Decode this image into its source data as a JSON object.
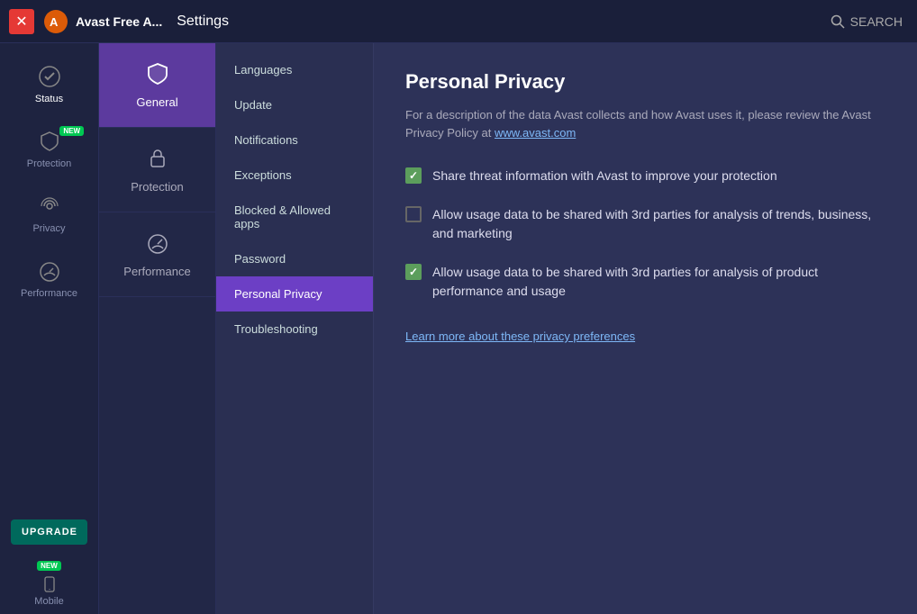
{
  "topbar": {
    "app_name": "Avast Free A...",
    "settings_label": "Settings",
    "search_label": "SEARCH"
  },
  "sidebar_icons": {
    "items": [
      {
        "id": "status",
        "label": "Status",
        "icon": "check-circle"
      },
      {
        "id": "protection",
        "label": "Protection",
        "icon": "shield",
        "badge": "NEW"
      },
      {
        "id": "privacy",
        "label": "Privacy",
        "icon": "fingerprint"
      },
      {
        "id": "performance",
        "label": "Performance",
        "icon": "gauge"
      }
    ],
    "upgrade_label": "UPGRADE",
    "mobile_label": "Mobile",
    "badge_new": "NEW"
  },
  "sidebar_categories": {
    "items": [
      {
        "id": "general",
        "label": "General",
        "icon": "shield",
        "active": true
      },
      {
        "id": "protection",
        "label": "Protection",
        "icon": "lock"
      },
      {
        "id": "performance",
        "label": "Performance",
        "icon": "gauge"
      }
    ]
  },
  "sidebar_menu": {
    "items": [
      {
        "id": "languages",
        "label": "Languages"
      },
      {
        "id": "update",
        "label": "Update"
      },
      {
        "id": "notifications",
        "label": "Notifications"
      },
      {
        "id": "exceptions",
        "label": "Exceptions"
      },
      {
        "id": "blocked-allowed",
        "label": "Blocked & Allowed apps"
      },
      {
        "id": "password",
        "label": "Password"
      },
      {
        "id": "personal-privacy",
        "label": "Personal Privacy",
        "active": true
      },
      {
        "id": "troubleshooting",
        "label": "Troubleshooting"
      }
    ]
  },
  "content": {
    "title": "Personal Privacy",
    "description_text": "For a description of the data Avast collects and how Avast uses it, please review the Avast Privacy Policy at ",
    "privacy_policy_link": "www.avast.com",
    "checkboxes": [
      {
        "id": "share-threat",
        "label": "Share threat information with Avast to improve your protection",
        "checked": true
      },
      {
        "id": "allow-usage-3rd",
        "label": "Allow usage data to be shared with 3rd parties for analysis of trends, business, and marketing",
        "checked": false
      },
      {
        "id": "allow-usage-product",
        "label": "Allow usage data to be shared with 3rd parties for analysis of product performance and usage",
        "checked": true
      }
    ],
    "learn_more_link": "Learn more about these privacy preferences"
  }
}
